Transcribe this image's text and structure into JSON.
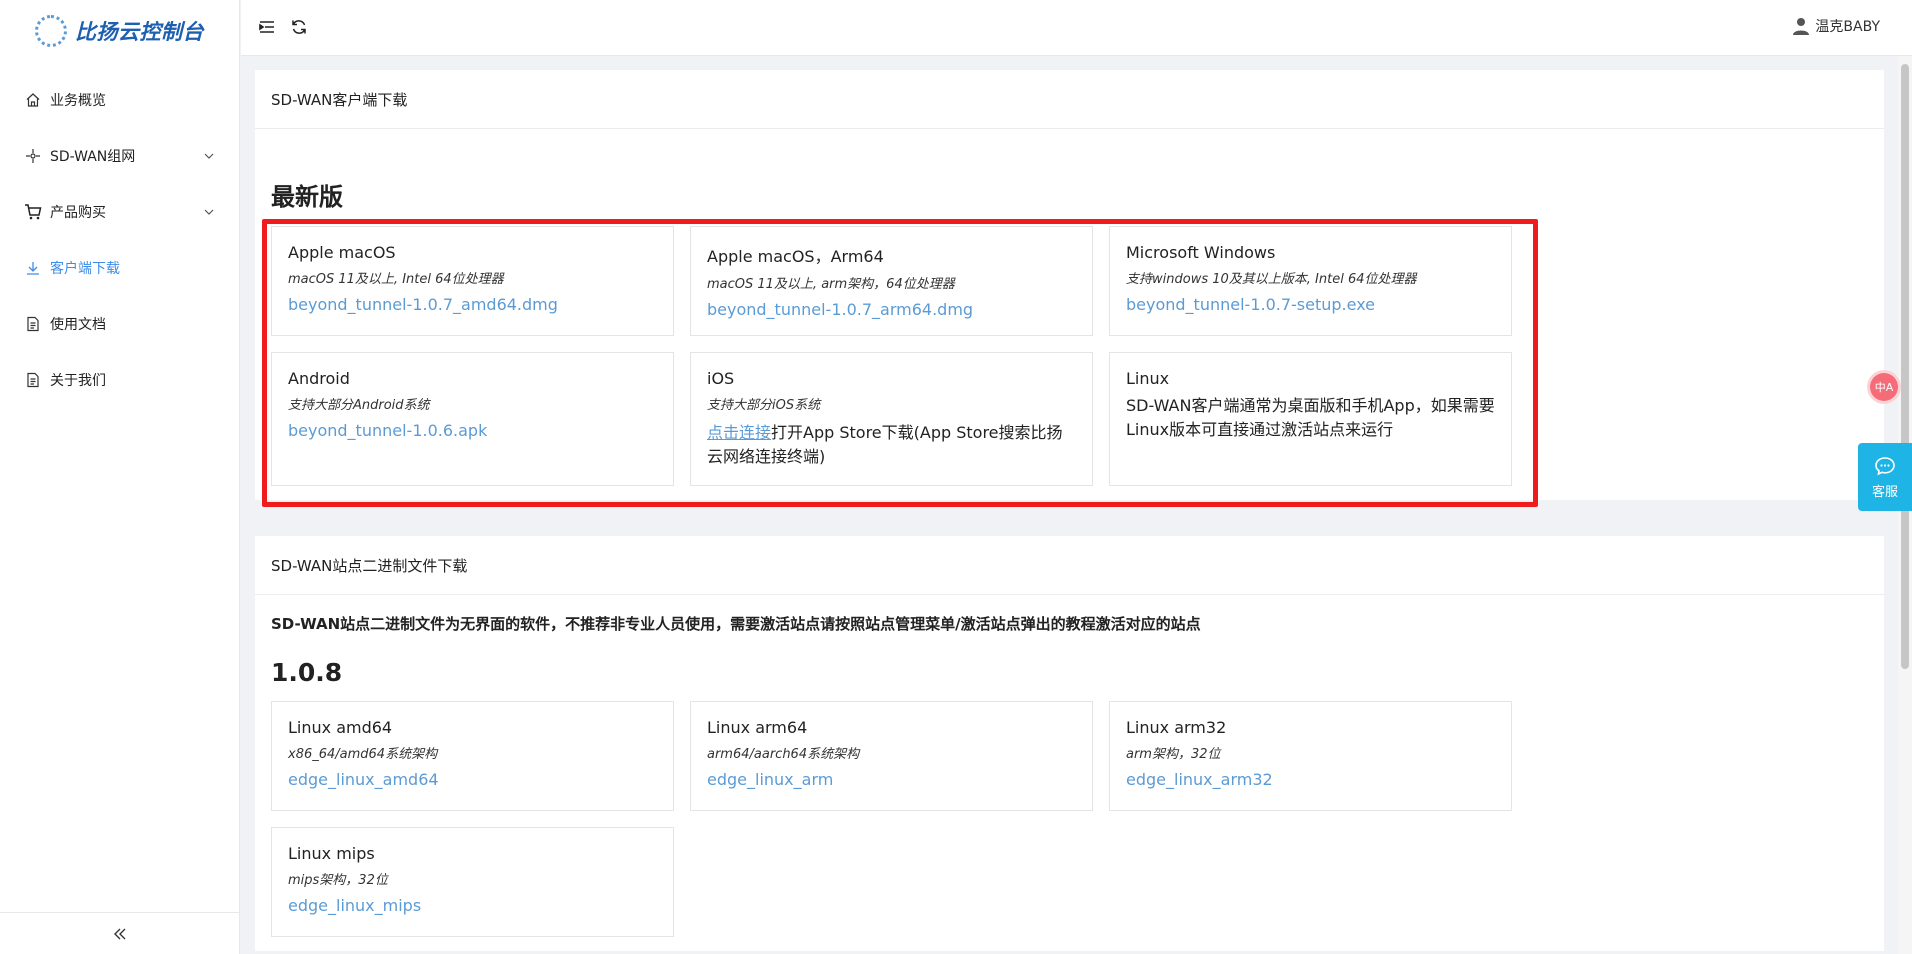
{
  "brand": {
    "name": "比扬云控制台",
    "accent": "#1d5fb0"
  },
  "sidebar": {
    "items": [
      {
        "label": "业务概览",
        "icon": "home-icon"
      },
      {
        "label": "SD-WAN组网",
        "icon": "network-icon",
        "expandable": true
      },
      {
        "label": "产品购买",
        "icon": "cart-icon",
        "expandable": true
      },
      {
        "label": "客户端下载",
        "icon": "download-icon",
        "active": true
      },
      {
        "label": "使用文档",
        "icon": "document-icon"
      },
      {
        "label": "关于我们",
        "icon": "info-document-icon"
      }
    ],
    "collapse_icon": "double-chevron-left-icon"
  },
  "header": {
    "menu_icon": "menu-fold-icon",
    "refresh_icon": "refresh-icon",
    "user_name": "温克BABY",
    "user_icon": "user-icon"
  },
  "client_download": {
    "card_title": "SD-WAN客户端下载",
    "section_title": "最新版",
    "items": [
      {
        "title": "Apple macOS",
        "subtitle": "macOS 11及以上, Intel 64位处理器",
        "link": "beyond_tunnel-1.0.7_amd64.dmg"
      },
      {
        "title": "Apple macOS，Arm64",
        "subtitle": "macOS 11及以上, arm架构，64位处理器",
        "link": "beyond_tunnel-1.0.7_arm64.dmg"
      },
      {
        "title": "Microsoft Windows",
        "subtitle": "支持windows 10及其以上版本, Intel 64位处理器",
        "link": "beyond_tunnel-1.0.7-setup.exe"
      },
      {
        "title": "Android",
        "subtitle": "支持大部分Android系统",
        "link": "beyond_tunnel-1.0.6.apk"
      },
      {
        "title": "iOS",
        "subtitle": "支持大部分iOS系统",
        "link_text": "点击连接",
        "desc": "打开App Store下载(App Store搜索比扬云网络连接终端)"
      },
      {
        "title": "Linux",
        "desc": "SD-WAN客户端通常为桌面版和手机App，如果需要Linux版本可直接通过激活站点来运行"
      }
    ],
    "highlight_color": "#ee1c1c"
  },
  "binary_download": {
    "card_title": "SD-WAN站点二进制文件下载",
    "notice": "SD-WAN站点二进制文件为无界面的软件，不推荐非专业人员使用，需要激活站点请按照站点管理菜单/激活站点弹出的教程激活对应的站点",
    "version": "1.0.8",
    "items": [
      {
        "title": "Linux amd64",
        "subtitle": "x86_64/amd64系统架构",
        "link": "edge_linux_amd64"
      },
      {
        "title": "Linux arm64",
        "subtitle": "arm64/aarch64系统架构",
        "link": "edge_linux_arm"
      },
      {
        "title": "Linux arm32",
        "subtitle": "arm架构，32位",
        "link": "edge_linux_arm32"
      },
      {
        "title": "Linux mips",
        "subtitle": "mips架构，32位",
        "link": "edge_linux_mips"
      }
    ]
  },
  "widgets": {
    "translate_label": "中A",
    "service_label": "客服",
    "service_icon": "chat-bubble-icon",
    "service_color": "#1fb4e6"
  }
}
